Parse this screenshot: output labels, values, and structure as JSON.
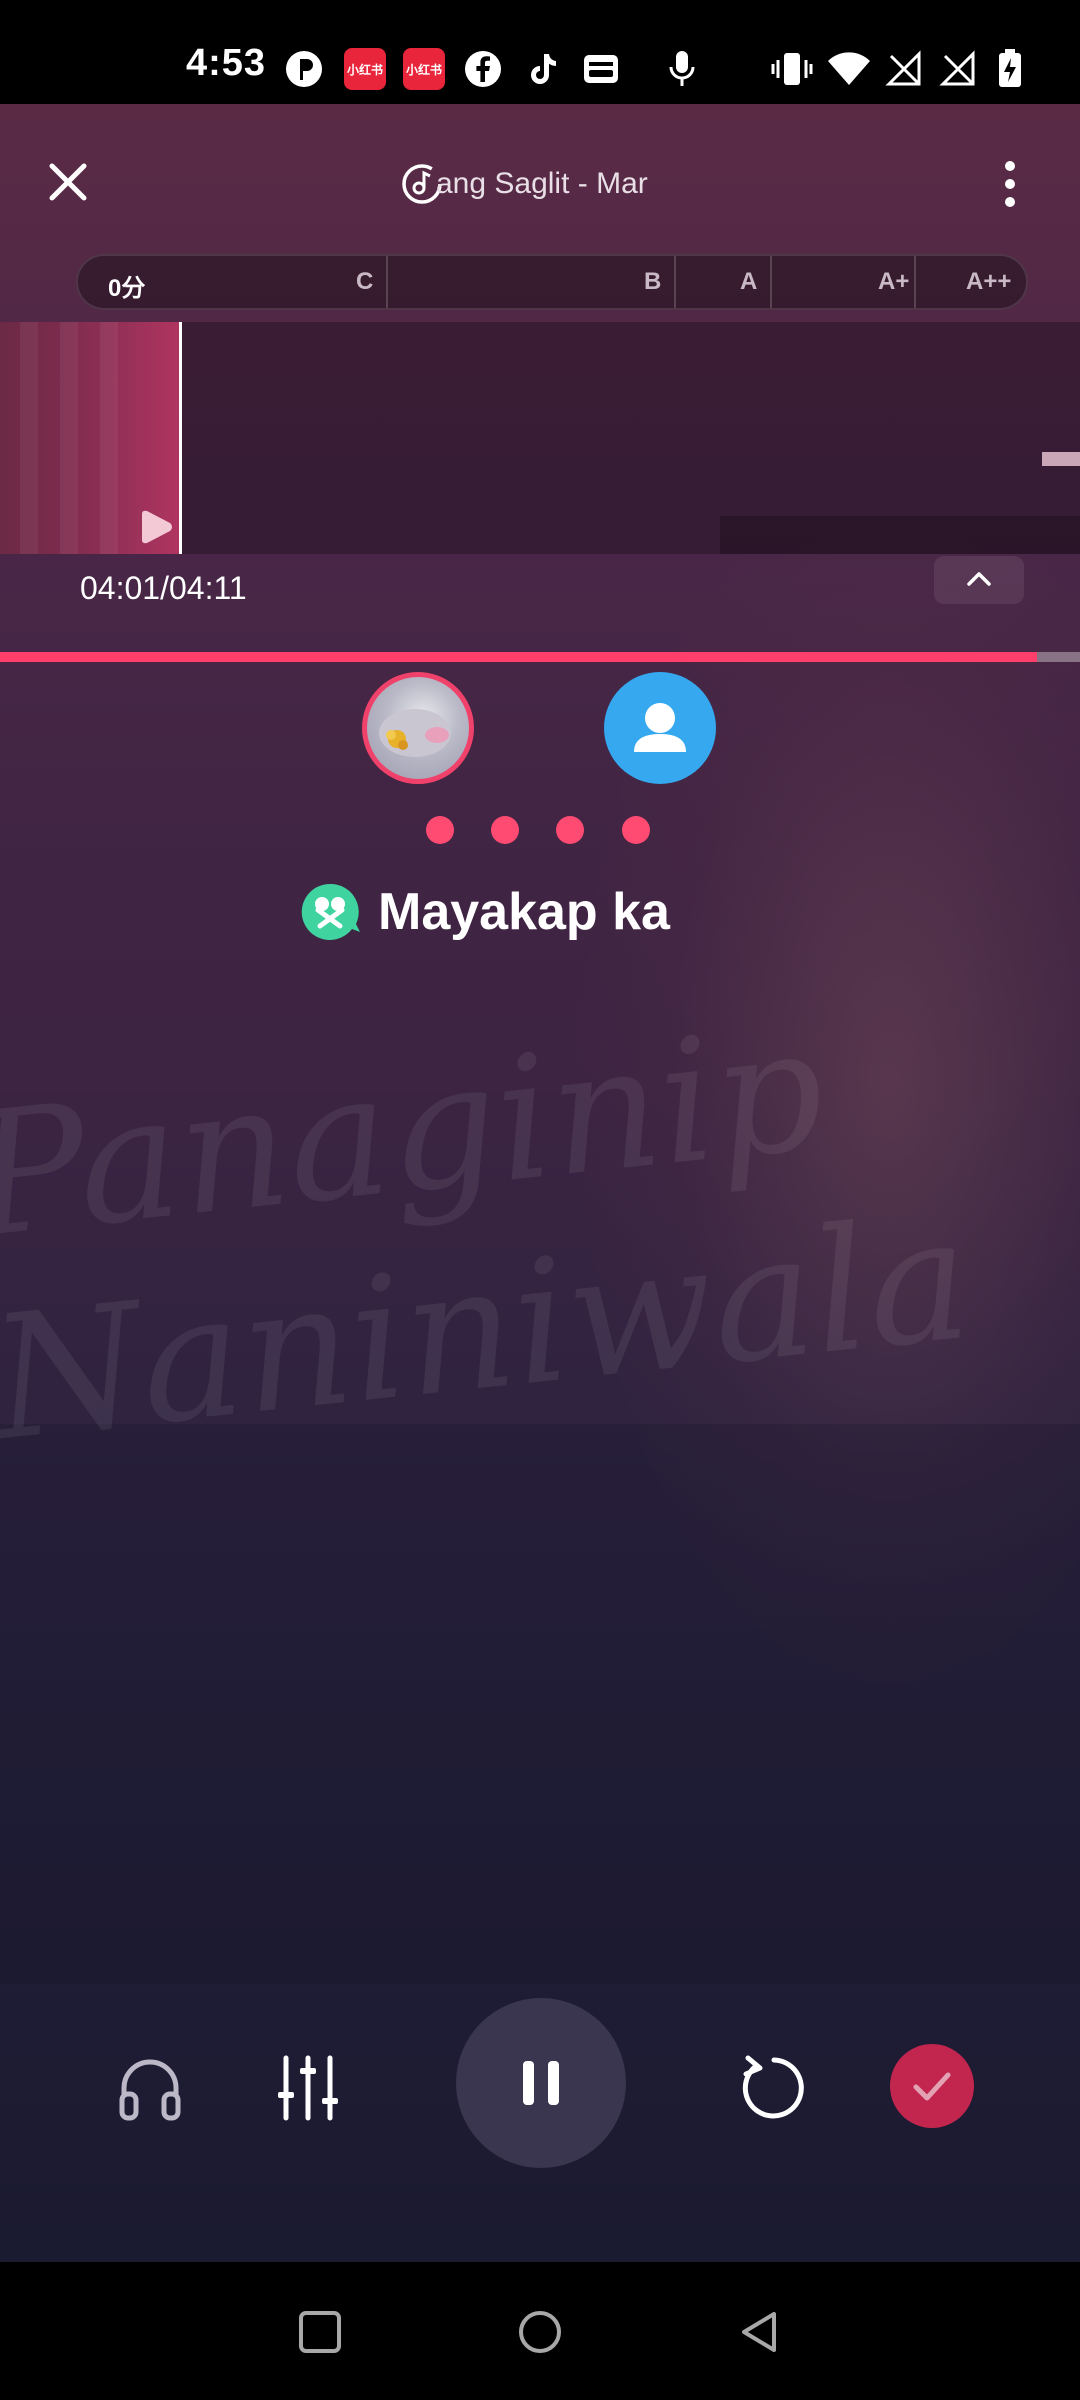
{
  "status_bar": {
    "time": "4:53",
    "badge_label": "小红书",
    "icons": [
      "pinterest-icon",
      "xiaohongshu-icon",
      "xiaohongshu-icon",
      "facebook-icon",
      "tiktok-icon",
      "wallet-icon",
      "mic-icon",
      "vibrate-icon",
      "wifi-icon",
      "no-sim-icon",
      "no-sim-icon",
      "battery-charging-icon"
    ]
  },
  "header": {
    "song_title": "ang Saglit - Mar"
  },
  "score_bar": {
    "current": "0分",
    "grades": [
      "C",
      "B",
      "A",
      "A+",
      "A++"
    ]
  },
  "playback": {
    "time": "04:01/04:11",
    "progress": 0.96
  },
  "singers": {
    "user_avatar": "avatar-user",
    "partner_avatar": "avatar-partner-placeholder"
  },
  "countdown_dots": 4,
  "lyric": {
    "line": "Mayakap ka"
  },
  "background_text": {
    "line1": "Panaginip",
    "line2": "Naniniwala"
  },
  "controls": {
    "headphone": "headphone-icon",
    "mixer": "mixer-icon",
    "pause": "pause-icon",
    "restart": "restart-icon",
    "done": "check-icon"
  },
  "colors": {
    "accent": "#ff3f6b",
    "partner_blue": "#36a8f0",
    "done_red": "#c2264f",
    "lyric_icon_green": "#3fd3a0"
  }
}
